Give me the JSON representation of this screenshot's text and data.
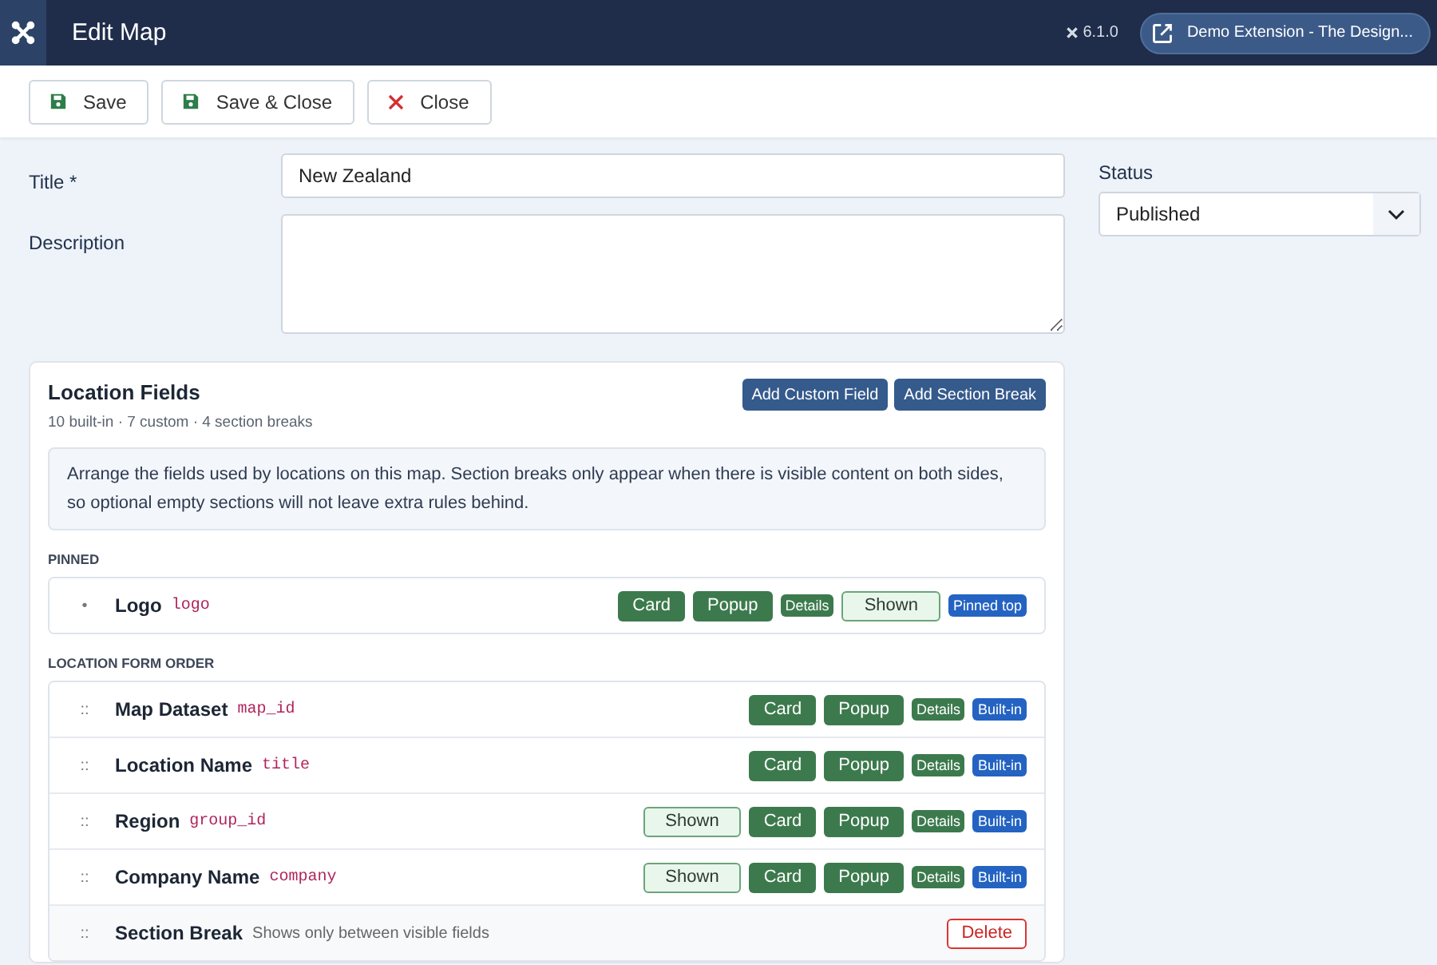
{
  "header": {
    "title": "Edit Map",
    "version": "6.1.0",
    "site_button": "Demo Extension - The Design..."
  },
  "toolbar": [
    {
      "label": "Save",
      "kind": "save"
    },
    {
      "label": "Save & Close",
      "kind": "save"
    },
    {
      "label": "Close",
      "kind": "close"
    }
  ],
  "form": {
    "title": {
      "label": "Title *",
      "value": "New Zealand"
    },
    "description": {
      "label": "Description"
    }
  },
  "status": {
    "label": "Status",
    "value": "Published"
  },
  "location_fields": {
    "title": "Location Fields",
    "summary": "10 built-in · 7 custom · 4 section breaks",
    "actions": [
      "Add Custom Field",
      "Add Section Break"
    ],
    "note": "Arrange the fields used by locations on this map. Section breaks only appear when there is visible content on both sides, so optional empty sections will not leave extra rules behind.",
    "groups": [
      {
        "heading": "PINNED",
        "rows": [
          {
            "kind": "field",
            "handle": "•",
            "name": "Logo",
            "key": "logo",
            "tags": [
              {
                "label": "Card",
                "kind": "card"
              },
              {
                "label": "Popup",
                "kind": "popup"
              },
              {
                "label": "Details",
                "kind": "details"
              },
              {
                "label": "Shown",
                "kind": "shown"
              },
              {
                "label": "Pinned top",
                "kind": "pinned"
              }
            ]
          }
        ]
      },
      {
        "heading": "LOCATION FORM ORDER",
        "rows": [
          {
            "kind": "field",
            "handle": "::",
            "name": "Map Dataset",
            "key": "map_id",
            "tags": [
              {
                "label": "Card",
                "kind": "card"
              },
              {
                "label": "Popup",
                "kind": "popup"
              },
              {
                "label": "Details",
                "kind": "details"
              },
              {
                "label": "Built-in",
                "kind": "builtin"
              }
            ]
          },
          {
            "kind": "field",
            "handle": "::",
            "name": "Location Name",
            "key": "title",
            "tags": [
              {
                "label": "Card",
                "kind": "card"
              },
              {
                "label": "Popup",
                "kind": "popup"
              },
              {
                "label": "Details",
                "kind": "details"
              },
              {
                "label": "Built-in",
                "kind": "builtin"
              }
            ]
          },
          {
            "kind": "field",
            "handle": "::",
            "name": "Region",
            "key": "group_id",
            "tags": [
              {
                "label": "Shown",
                "kind": "shown"
              },
              {
                "label": "Card",
                "kind": "card"
              },
              {
                "label": "Popup",
                "kind": "popup"
              },
              {
                "label": "Details",
                "kind": "details"
              },
              {
                "label": "Built-in",
                "kind": "builtin"
              }
            ]
          },
          {
            "kind": "field",
            "handle": "::",
            "name": "Company Name",
            "key": "company",
            "tags": [
              {
                "label": "Shown",
                "kind": "shown"
              },
              {
                "label": "Card",
                "kind": "card"
              },
              {
                "label": "Popup",
                "kind": "popup"
              },
              {
                "label": "Details",
                "kind": "details"
              },
              {
                "label": "Built-in",
                "kind": "builtin"
              }
            ]
          },
          {
            "kind": "break",
            "handle": "::",
            "name": "Section Break",
            "hint": "Shows only between visible fields",
            "tags": [
              {
                "label": "Delete",
                "kind": "delete"
              }
            ]
          }
        ]
      }
    ]
  }
}
